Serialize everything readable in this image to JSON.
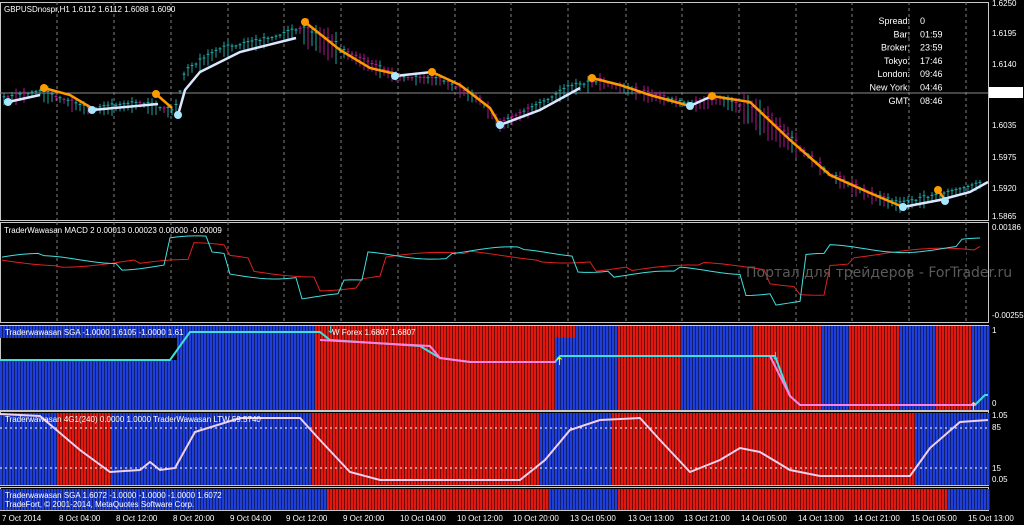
{
  "chart_data": [
    {
      "type": "candlestick",
      "title": "GBPUSDnospr,H1  1.6112 1.6112 1.6088 1.6090",
      "y_ticks": [
        "1.6250",
        "1.6195",
        "1.6140",
        "1.6090",
        "1.6035",
        "1.5975",
        "1.5920",
        "1.5865"
      ],
      "current_price": "1.6090",
      "info_panel": [
        {
          "label": "Spread:",
          "value": "0"
        },
        {
          "label": "Bar:",
          "value": "01:59"
        },
        {
          "label": "Broker:",
          "value": "23:59"
        },
        {
          "label": "Tokyo:",
          "value": "17:46"
        },
        {
          "label": "London:",
          "value": "09:46"
        },
        {
          "label": "New York:",
          "value": "04:46"
        },
        {
          "label": "GMT:",
          "value": "08:46"
        }
      ]
    },
    {
      "type": "histogram",
      "title": "TraderWawasan MACD 2 0.00013 0.00023 0.00000 -0.00009",
      "y_ticks": [
        "0.00186",
        "-0.00255"
      ],
      "watermark": "Портал для трейдеров - ForTrader.ru"
    },
    {
      "type": "bar",
      "title": "Traderwawasan SGA -1.0000 1.6105 -1.0000 1.61",
      "title2": "W Forex 1.6807 1.6807",
      "y_ticks": [
        "1",
        "0"
      ]
    },
    {
      "type": "bar",
      "title": "Traderwawasan 4G1(240) 0.0000 1.0000  TraderWawasan LTW 59.5740",
      "y_ticks": [
        "1.05",
        "85",
        "15",
        "0.05"
      ]
    },
    {
      "type": "bar",
      "title": "Traderwawasan SGA 1.6072 -1.0000 -1.0000 -1.0000 1.6072",
      "subtitle": "TradeFort, © 2001-2014, MetaQuotes Software Corp."
    }
  ],
  "x_axis_labels": [
    "7 Oct 2014",
    "8 Oct 04:00",
    "8 Oct 12:00",
    "8 Oct 20:00",
    "9 Oct 04:00",
    "9 Oct 12:00",
    "9 Oct 20:00",
    "10 Oct 04:00",
    "10 Oct 12:00",
    "10 Oct 20:00",
    "13 Oct 05:00",
    "13 Oct 13:00",
    "13 Oct 21:00",
    "14 Oct 05:00",
    "14 Oct 13:00",
    "14 Oct 21:00",
    "15 Oct 05:00",
    "15 Oct 13:00"
  ],
  "colors": {
    "background": "#000000",
    "bull": "#1fa5a5",
    "bear": "#b0178f",
    "blue": "#1f3fd8",
    "red": "#e0180f",
    "orange": "#ff9900",
    "white_line": "#dde6ff",
    "cyan": "#40e0e0",
    "pink": "#ff80e0",
    "grid": "#808080"
  }
}
